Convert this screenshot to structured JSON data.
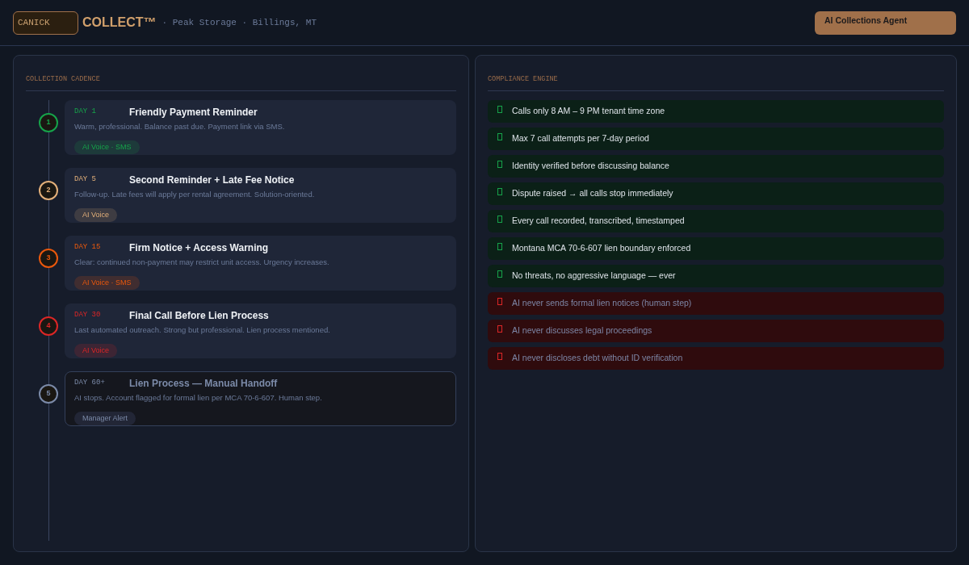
{
  "header": {
    "logo_badge": "CANICK",
    "product": "COLLECT™",
    "subtitle": "· Peak Storage · Billings, MT",
    "agent_button": "AI Collections Agent"
  },
  "cadence": {
    "title": "COLLECTION CADENCE",
    "steps": [
      {
        "number": "1",
        "day": "DAY 1",
        "title": "Friendly Payment Reminder",
        "description": "Warm, professional. Balance past due. Payment link via SMS.",
        "channel": "AI Voice · SMS",
        "color": "#16a34a",
        "manual": false
      },
      {
        "number": "2",
        "day": "DAY 5",
        "title": "Second Reminder + Late Fee Notice",
        "description": "Follow-up. Late fees will apply per rental agreement. Solution-oriented.",
        "channel": "AI Voice",
        "color": "#e3b07a",
        "manual": false
      },
      {
        "number": "3",
        "day": "DAY 15",
        "title": "Firm Notice + Access Warning",
        "description": "Clear: continued non-payment may restrict unit access. Urgency increases.",
        "channel": "AI Voice · SMS",
        "color": "#ea580c",
        "manual": false
      },
      {
        "number": "4",
        "day": "DAY 30",
        "title": "Final Call Before Lien Process",
        "description": "Last automated outreach. Strong but professional. Lien process mentioned.",
        "channel": "AI Voice",
        "color": "#dc2626",
        "manual": false
      },
      {
        "number": "5",
        "day": "DAY 60+",
        "title": "Lien Process — Manual Handoff",
        "description": "AI stops. Account flagged for formal lien per MCA 70-6-607. Human step.",
        "channel": "Manager Alert",
        "color": "#7b8aa8",
        "manual": true
      }
    ]
  },
  "compliance": {
    "title": "COMPLIANCE ENGINE",
    "rules": [
      {
        "kind": "required",
        "text": "Calls only 8 AM – 9 PM tenant time zone"
      },
      {
        "kind": "required",
        "text": "Max 7 call attempts per 7-day period"
      },
      {
        "kind": "required",
        "text": "Identity verified before discussing balance"
      },
      {
        "kind": "required",
        "text": "Dispute raised → all calls stop immediately"
      },
      {
        "kind": "required",
        "text": "Every call recorded, transcribed, timestamped"
      },
      {
        "kind": "required",
        "text": "Montana MCA 70-6-607 lien boundary enforced"
      },
      {
        "kind": "required",
        "text": "No threats, no aggressive language — ever"
      },
      {
        "kind": "prohibited",
        "text": "AI never sends formal lien notices (human step)"
      },
      {
        "kind": "prohibited",
        "text": "AI never discusses legal proceedings"
      },
      {
        "kind": "prohibited",
        "text": "AI never discloses debt without ID verification"
      }
    ]
  }
}
